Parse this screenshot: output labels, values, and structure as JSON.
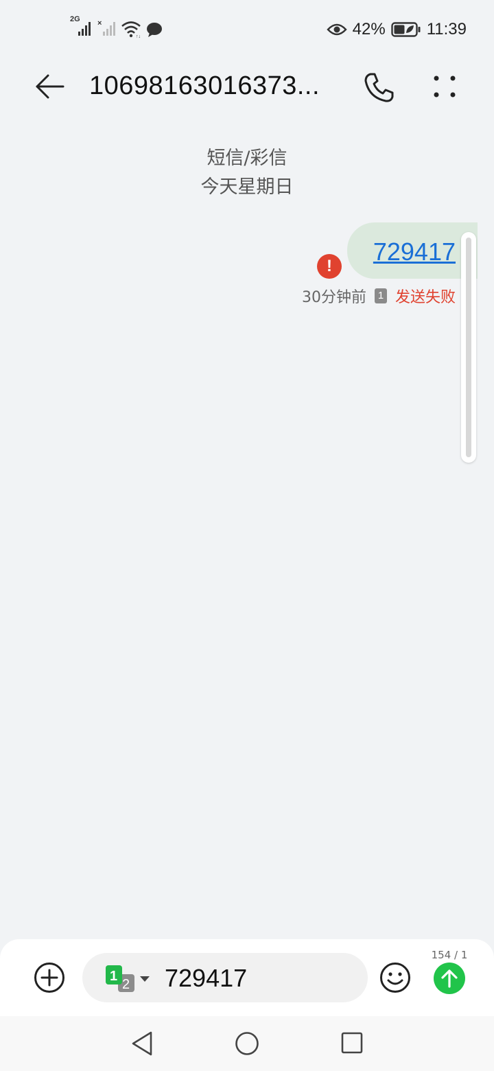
{
  "status_bar": {
    "network_type": "2G",
    "battery_percent": "42%",
    "time": "11:39",
    "icons": [
      "signal-1-icon",
      "signal-2-no-service-icon",
      "wifi-icon",
      "chat-bubble-icon",
      "eye-comfort-icon",
      "battery-saver-icon"
    ]
  },
  "header": {
    "title": "10698163016373...",
    "icons": [
      "back-arrow-icon",
      "phone-icon",
      "more-dots-icon"
    ]
  },
  "conversation": {
    "channel_label": "短信/彩信",
    "date_label": "今天星期日",
    "messages": [
      {
        "text": "729417",
        "time_ago": "30分钟前",
        "sim_slot": "1",
        "status": "发送失败",
        "error_icon": "!"
      }
    ]
  },
  "composer": {
    "input_value": "729417",
    "char_counter": "154 / 1",
    "sim_selector": {
      "primary": "1",
      "secondary": "2"
    },
    "icons": [
      "add-circle-icon",
      "sim-select-icon",
      "emoji-icon",
      "send-icon"
    ]
  },
  "colors": {
    "background": "#f1f3f5",
    "bubble": "#dbe9dd",
    "link": "#1a6fd6",
    "error": "#e0422f",
    "send_button": "#21c44a",
    "sim_primary": "#22b84a"
  },
  "nav_bar": {
    "icons": [
      "nav-back-icon",
      "nav-home-icon",
      "nav-recent-icon"
    ]
  }
}
